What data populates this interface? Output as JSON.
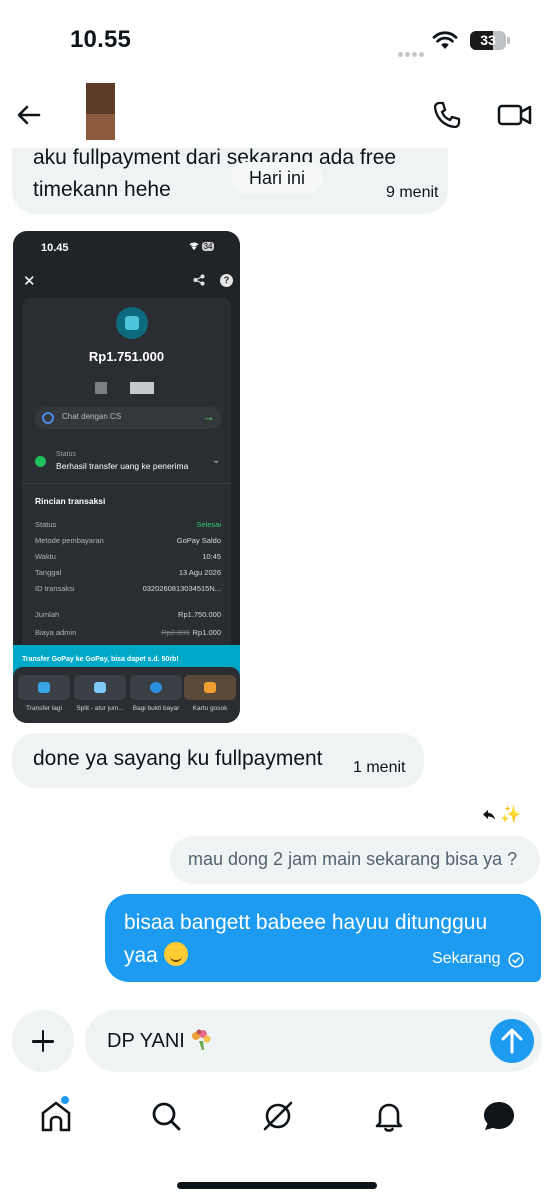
{
  "status_bar": {
    "time": "10.55",
    "battery": "33"
  },
  "chat": {
    "messages": [
      {
        "direction": "in",
        "text": "aku fullpayment dari sekarang ada free timekann hehe",
        "time": "9 menit"
      },
      {
        "direction": "in",
        "type": "image"
      },
      {
        "direction": "in",
        "text": "done ya sayang ku fullpayment",
        "time": "1 menit"
      },
      {
        "direction": "out",
        "text": "mau dong 2 jam main sekarang bisa ya ?"
      },
      {
        "direction": "out",
        "text": "bisaa bangett babeee hayuu ditungguu yaa",
        "time": "Sekarang"
      }
    ],
    "date_separator": "Hari ini"
  },
  "screenshot": {
    "time": "10.45",
    "battery": "34",
    "amount": "Rp1.751.000",
    "chat_cs": "Chat dengan CS",
    "status_label": "Status",
    "status_value": "Berhasil transfer uang ke penerima",
    "section_title": "Rincian transaksi",
    "rows": [
      {
        "key": "Status",
        "value": "Selesai"
      },
      {
        "key": "Metode pembayaran",
        "value": "GoPay Saldo"
      },
      {
        "key": "Waktu",
        "value": "10:45"
      },
      {
        "key": "Tanggal",
        "value": "13 Agu 2026"
      },
      {
        "key": "ID transaksi",
        "value": "0320260813034515N..."
      },
      {
        "key": "Jumlah",
        "value": "Rp1.750.000"
      },
      {
        "key": "Biaya admin",
        "old_value": "Rp2.000",
        "value": "Rp1.000"
      }
    ],
    "banner": "Transfer GoPay ke GoPay, bisa dapet s.d. 50rb!",
    "actions": [
      "Transfer lagi",
      "Split - atur jum...",
      "Bagi bukti bayar",
      "Kartu gosok"
    ]
  },
  "composer": {
    "value": "DP YANI"
  },
  "colors": {
    "accent": "#1d9bf0",
    "bubble_gray": "#eff3f4",
    "text": "#0f1419"
  },
  "icons": [
    "back-arrow-icon",
    "phone-icon",
    "video-icon",
    "reply-icon",
    "sparkle-icon",
    "check-circle-icon",
    "plus-icon",
    "send-arrow-icon",
    "home-icon",
    "search-icon",
    "grok-icon",
    "bell-icon",
    "messages-icon"
  ]
}
